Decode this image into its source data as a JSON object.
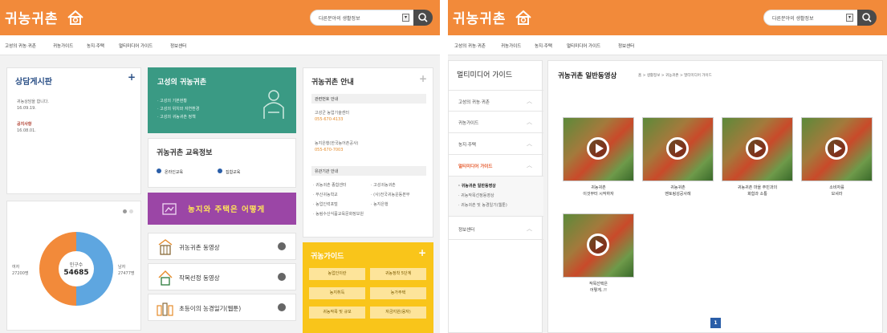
{
  "left": {
    "logo": "귀농귀촌",
    "search": {
      "placeholder": "다른분야의 생활정보",
      "select_glyph": "▾"
    },
    "nav": [
      "고성의 귀농·귀촌",
      "귀농가이드",
      "농지·주택",
      "멀티미디어 가이드",
      "정보센터"
    ],
    "consult": {
      "title": "상담게시판",
      "plus": "+",
      "item1_text": "귀농상담을 합니다.",
      "item1_date": "16.09.19.",
      "item2_title": "공지사항",
      "item2_date": "16.08.01."
    },
    "goseong": {
      "title": "고성의 귀농귀촌",
      "items": [
        "· 고성의 기본현황",
        "· 고성의 위치와 자연환경",
        "· 고성의 귀농귀촌 정책"
      ]
    },
    "education": {
      "title": "귀농귀촌 교육정보",
      "option1": "온라인교육",
      "option2": "집합교육"
    },
    "banner": "농지와 주택은 어떻게",
    "videos": [
      {
        "label": "귀농귀촌 동영상",
        "icon": "building-icon"
      },
      {
        "label": "작목선정 동영상",
        "icon": "house-icon"
      },
      {
        "label": "초등이의 농경일기(웹툰)",
        "icon": "people-icon"
      }
    ],
    "population": {
      "female_label": "여자",
      "female_value": "27200명",
      "center_label": "인구수",
      "total": "54685",
      "male_label": "남자",
      "male_value": "27477명",
      "male_share": 0.5,
      "colors": {
        "female": "#f28a3a",
        "male": "#5ea6e0"
      }
    },
    "guide_info": {
      "title": "귀농귀촌 안내",
      "plus": "+",
      "section1": "관련번호 안내",
      "contact1_name": "고성군 농업기술센터",
      "contact1_phone": "055-670-4133",
      "contact2_name": "농지은행(한국농어촌공사)",
      "contact2_phone": "055-670-7003",
      "section2": "유관기관 안내",
      "links_left": [
        "· 귀농귀촌 종합센터",
        "· 부산귀농학교",
        "· 농업인력포털",
        "· 농림수산식품교육문화정보원"
      ],
      "links_right": [
        "· 고성귀농귀촌",
        "· (사)전국귀농운동본부",
        "· 농지은행"
      ]
    },
    "yellow_guide": {
      "title": "귀농가이드",
      "plus": "+",
      "buttons": [
        "농업인이란",
        "귀농정착 5단계",
        "농지취득",
        "농가주택",
        "귀농작목 및 규모",
        "자금지원(융자)"
      ]
    }
  },
  "right": {
    "logo": "귀농귀촌",
    "search": {
      "placeholder": "다른분야의 생활정보",
      "select_glyph": "▾"
    },
    "nav": [
      "고성의 귀농·귀촌",
      "귀농가이드",
      "농지·주택",
      "멀티미디어 가이드",
      "정보센터"
    ],
    "sidebar": {
      "title": "멀티미디어 가이드",
      "items": [
        "고성의 귀농·귀촌",
        "귀농가이드",
        "농지·주택",
        "멀티미디어 가이드",
        "정보센터"
      ],
      "active_index": 3,
      "subitems": [
        "· 귀농귀촌 일반동영상",
        "· 귀농작목선정동영상",
        "· 귀농귀촌 및 농경일기(웹툰)"
      ],
      "chevron": "︿"
    },
    "content": {
      "title": "귀농귀촌 일반동영상",
      "breadcrumb": "홈 > 생활정보 > 귀농귀촌 > 멀티미디어 가이드",
      "videos": [
        {
          "line1": "귀농귀촌",
          "line2": "이것부터 시작하자"
        },
        {
          "line1": "귀농귀촌",
          "line2": "멘토링성공사례"
        },
        {
          "line1": "귀농귀촌 마을 주민과의",
          "line2": "화합과 소통"
        },
        {
          "line1": "소비자를",
          "line2": "모셔라"
        },
        {
          "line1": "작목선택은",
          "line2": "어떻게..!!"
        }
      ],
      "page": "1"
    }
  }
}
